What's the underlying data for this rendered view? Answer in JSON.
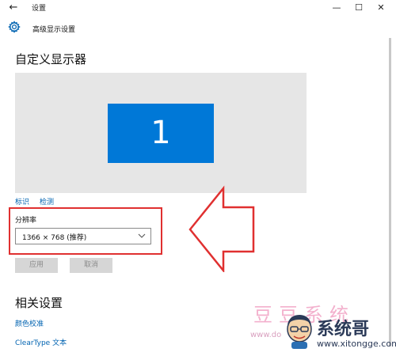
{
  "window": {
    "title": "设置",
    "back_glyph": "←",
    "minimize_glyph": "—",
    "maximize_glyph": "☐",
    "close_glyph": "✕"
  },
  "header": {
    "icon": "gear-icon",
    "title": "高级显示设置"
  },
  "main": {
    "page_title": "自定义显示器",
    "monitor_label": "1",
    "identify_link": "标识",
    "detect_link": "检测",
    "resolution": {
      "label": "分辨率",
      "value": "1366 × 768 (推荐)"
    },
    "apply_button": "应用",
    "cancel_button": "取消",
    "related_title": "相关设置",
    "color_calibration_link": "颜色校准",
    "cleartype_link": "ClearType 文本"
  },
  "overlay": {
    "watermark_text": "豆豆系统",
    "watermark_url": "www.do",
    "logo_name": "系统哥",
    "logo_site": "www.xitongge.com",
    "highlight_color": "#e03030",
    "accent_color": "#0078d7",
    "link_color": "#0063b1"
  }
}
